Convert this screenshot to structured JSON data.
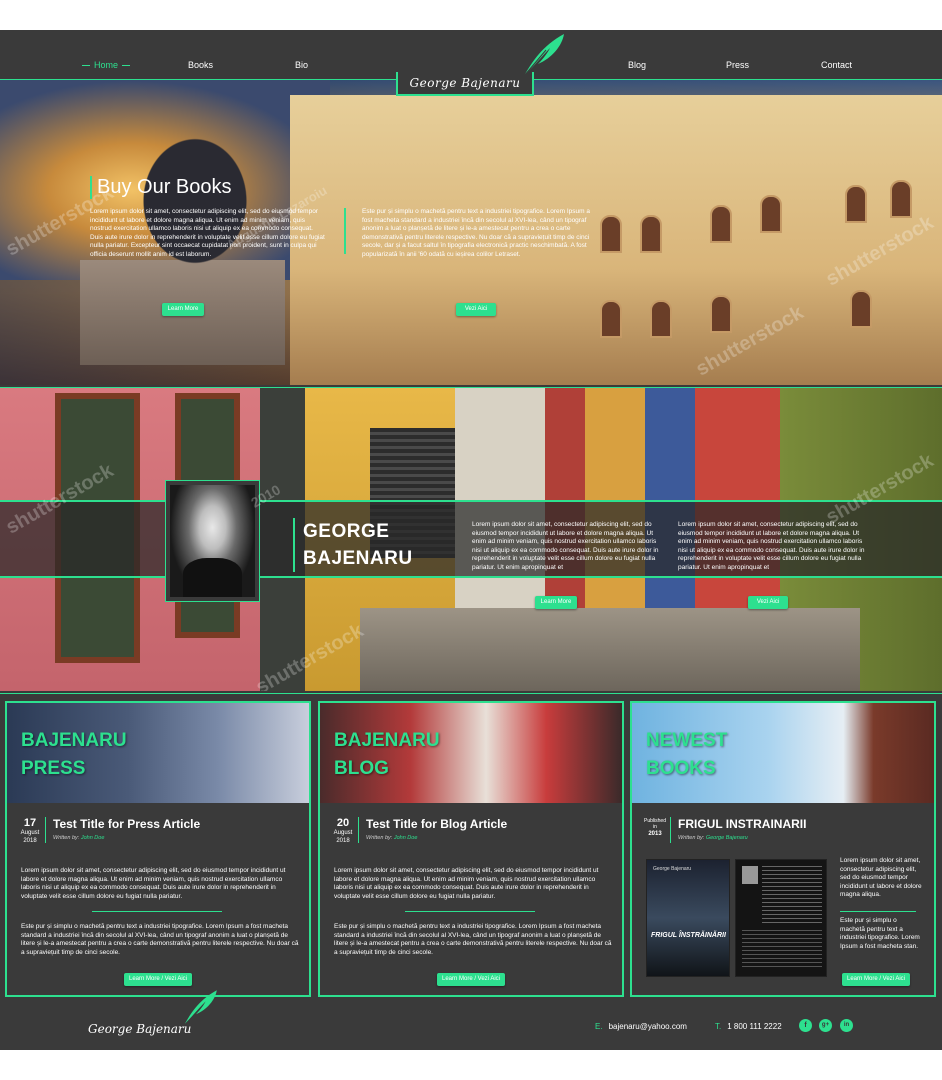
{
  "nav": {
    "items": [
      "Home",
      "Books",
      "Bio",
      "Blog",
      "Press",
      "Contact"
    ],
    "logo": "George Bajenaru"
  },
  "hero1": {
    "title": "Buy Our Books",
    "text_left": "Lorem ipsum dolor sit amet, consectetur adipiscing elit, sed do eiusmod tempor incididunt ut labore et dolore magna aliqua. Ut enim ad minim veniam, quis nostrud exercitation ullamco laboris nisi ut aliquip ex ea commodo consequat. Duis aute irure dolor in reprehenderit in voluptate velit esse cillum dolore eu fugiat nulla pariatur. Excepteur sint occaecat cupidatat non proident, sunt in culpa qui officia deserunt mollit anim id est laborum.",
    "text_right": "Este pur și simplu o machetă pentru text a industriei tipografice. Lorem Ipsum a fost macheta standard a industriei încă din secolul al XVI-lea, când un tipograf anonim a luat o planșetă de litere și le-a amestecat pentru a crea o carte demonstrativă pentru literele respective. Nu doar că a supraviețuit timp de cinci secole, dar și a facut saltul în tipografia electronică practic neschimbată. A fost popularizată în anii '60 odată cu ieșirea colilor Letraset.",
    "btn_left": "Learn More",
    "btn_right": "Vezi Aici"
  },
  "hero2": {
    "name_line1": "GEORGE",
    "name_line2": "BAJENARU",
    "text1": "Lorem ipsum dolor sit amet, consectetur adipiscing elit, sed do eiusmod tempor incididunt ut labore et dolore magna aliqua. Ut enim ad minim veniam, quis nostrud exercitation ullamco laboris nisi ut aliquip ex ea commodo consequat. Duis aute irure dolor in reprehenderit in voluptate velit esse cillum dolore eu fugiat nulla pariatur. Ut enim apropinquat et",
    "text2": "Lorem ipsum dolor sit amet, consectetur adipiscing elit, sed do eiusmod tempor incididunt ut labore et dolore magna aliqua. Ut enim ad minim veniam, quis nostrud exercitation ullamco laboris nisi ut aliquip ex ea commodo consequat. Duis aute irure dolor in reprehenderit in voluptate velit esse cillum dolore eu fugiat nulla pariatur. Ut enim apropinquat et",
    "btn1": "Learn More",
    "btn2": "Vezi Aici"
  },
  "cards": [
    {
      "img_title_1": "BAJENARU",
      "img_title_2": "PRESS",
      "day": "17",
      "month": "August",
      "year": "2018",
      "title": "Test Title for Press Article",
      "by": "Written by:",
      "author": "John Doe",
      "p1": "Lorem ipsum dolor sit amet, consectetur adipiscing elit, sed do eiusmod tempor incididunt ut labore et dolore magna aliqua. Ut enim ad minim veniam, quis nostrud exercitation ullamco laboris nisi ut aliquip ex ea commodo consequat. Duis aute irure dolor in reprehenderit in voluptate velit esse cillum dolore eu fugiat nulla pariatur.",
      "p2": "Este pur și simplu o machetă pentru text a industriei tipografice. Lorem Ipsum a fost macheta standard a industriei încă din secolul al XVI-lea, când un tipograf anonim a luat o planșetă de litere și le-a amestecat pentru a crea o carte demonstrativă pentru literele respective. Nu doar că a supraviețuit timp de cinci secole.",
      "btn": "Learn More / Vezi Aici"
    },
    {
      "img_title_1": "BAJENARU",
      "img_title_2": "BLOG",
      "day": "20",
      "month": "August",
      "year": "2018",
      "title": "Test Title for Blog Article",
      "by": "Written by:",
      "author": "John Doe",
      "p1": "Lorem ipsum dolor sit amet, consectetur adipiscing elit, sed do eiusmod tempor incididunt ut labore et dolore magna aliqua. Ut enim ad minim veniam, quis nostrud exercitation ullamco laboris nisi ut aliquip ex ea commodo consequat. Duis aute irure dolor in reprehenderit in voluptate velit esse cillum dolore eu fugiat nulla pariatur.",
      "p2": "Este pur și simplu o machetă pentru text a industriei tipografice. Lorem Ipsum a fost macheta standard a industriei încă din secolul al XVI-lea, când un tipograf anonim a luat o planșetă de litere și le-a amestecat pentru a crea o carte demonstrativă pentru literele respective. Nu doar că a supraviețuit timp de cinci secole.",
      "btn": "Learn More / Vezi Aici"
    },
    {
      "img_title_1": "NEWEST",
      "img_title_2": "BOOKS",
      "pub_label": "Published in",
      "year": "2013",
      "title": "FRIGUL INSTRAINARII",
      "by": "Written by:",
      "author": "George Bajenaru",
      "book_title": "FRIGUL ÎNSTRĂINĂRII",
      "book_author": "George Bajenaru",
      "p1": "Lorem ipsum dolor sit amet, consectetur adipiscing elit, sed do eiusmod tempor incididunt ut labore et dolore magna aliqua.",
      "p2": "Este pur și simplu o machetă pentru text a industriei tipografice. Lorem Ipsum a fost macheta stan.",
      "btn": "Learn More / Vezi Aici"
    }
  ],
  "footer": {
    "logo": "George Bajenaru",
    "email_label": "E.",
    "email": "bajenaru@yahoo.com",
    "phone_label": "T.",
    "phone": "1 800 111 2222",
    "social": [
      "f",
      "g+",
      "in"
    ]
  },
  "watermarks": [
    "shutterstock",
    "Augustin Lazaroiu",
    "2010"
  ],
  "colors": {
    "accent": "#2de08f",
    "bg": "#3a3a3a"
  }
}
